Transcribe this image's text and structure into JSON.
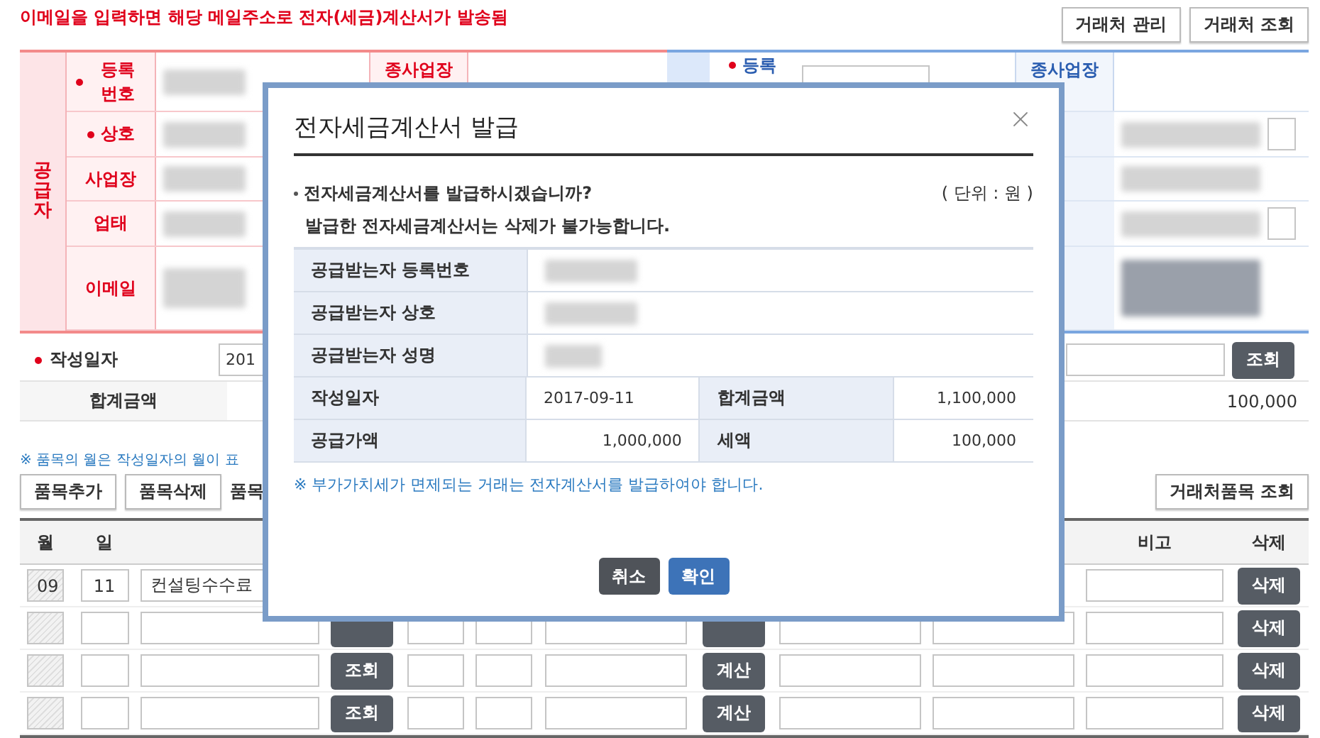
{
  "notice": "이메일을 입력하면 해당 메일주소로 전자(세금)계산서가 발송됨",
  "top_buttons": [
    "거래처 관리",
    "거래처 조회"
  ],
  "supplier": {
    "section_label": "공급자",
    "branch_label": "종사업장",
    "fields": [
      {
        "label": "등록 번호",
        "required": true
      },
      {
        "label": "상호",
        "required": true
      },
      {
        "label": "사업장",
        "required": false
      },
      {
        "label": "업태",
        "required": false
      },
      {
        "label": "이메일",
        "required": false
      }
    ]
  },
  "buyer": {
    "label": "등록",
    "required": true,
    "branch_label": "종사업장"
  },
  "issue_date": {
    "label": "작성일자",
    "required": true,
    "value": "201",
    "button": "조회"
  },
  "total": {
    "label": "합계금액",
    "value": "100,000"
  },
  "items_note": "※ 품목의 월은 작성일자의 월이 표",
  "item_buttons": [
    "품목추가",
    "품목삭제"
  ],
  "item_buttons_trailing": "품목",
  "lookup_button": "거래처품목 조회",
  "items_table": {
    "columns": [
      {
        "label": "월"
      },
      {
        "label": "일"
      },
      {
        "label": "비고"
      },
      {
        "label": "삭제"
      }
    ],
    "rows": [
      {
        "kind": "first",
        "month": "09",
        "day": "11",
        "item": "컨설팅수수료",
        "delete": "삭제"
      },
      {
        "kind": "hidden_labels",
        "delete": "삭제"
      },
      {
        "kind": "full",
        "lookup": "조회",
        "calc": "계산",
        "delete": "삭제"
      },
      {
        "kind": "full",
        "lookup": "조회",
        "calc": "계산",
        "delete": "삭제"
      }
    ]
  },
  "dialog": {
    "title": "전자세금계산서 발급",
    "question": "전자세금계산서를 발급하시겠습니까?",
    "unit": "( 단위 : 원 )",
    "warning": "발급한 전자세금계산서는 삭제가 불가능합니다.",
    "recipient_rows": [
      {
        "label": "공급받는자 등록번호"
      },
      {
        "label": "공급받는자 상호"
      },
      {
        "label": "공급받는자 성명"
      }
    ],
    "amount_rows": [
      {
        "cells": [
          {
            "label": "작성일자",
            "value": "2017-09-11",
            "kind": "date"
          },
          {
            "label": "합계금액",
            "value": "1,100,000",
            "kind": "amount"
          }
        ]
      },
      {
        "cells": [
          {
            "label": "공급가액",
            "value": "1,000,000",
            "kind": "amount"
          },
          {
            "label": "세액",
            "value": "100,000",
            "kind": "amount"
          }
        ]
      }
    ],
    "note": "※ 부가가치세가 면제되는 거래는 전자계산서를 발급하여야 합니다.",
    "buttons": [
      {
        "label": "취소",
        "kind": "cancel"
      },
      {
        "label": "확인",
        "kind": "confirm"
      }
    ]
  }
}
